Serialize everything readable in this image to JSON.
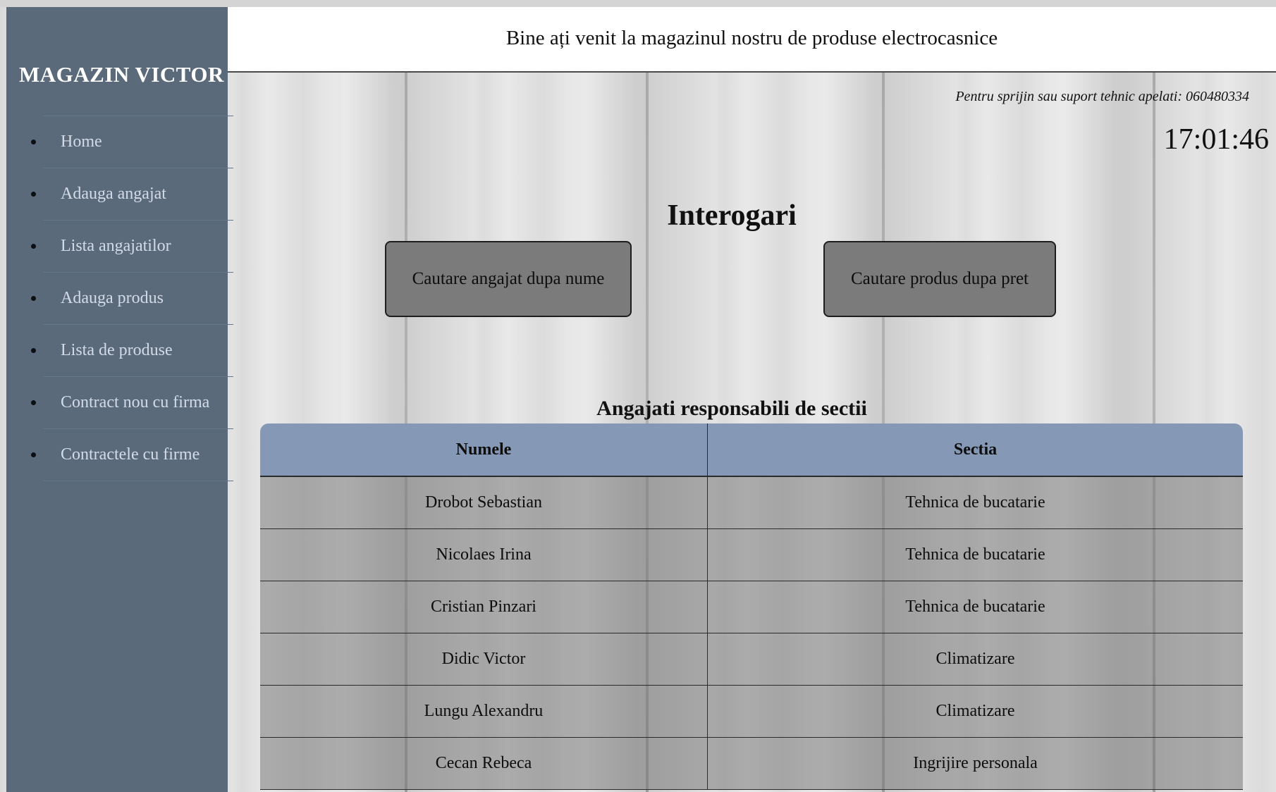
{
  "colors": {
    "sidebar_bg": "#5a6a7b",
    "sidebar_link": "#d3dbe6",
    "table_header_bg": "#8599b6",
    "button_bg": "#7b7b7b"
  },
  "sidebar": {
    "brand": "MAGAZIN VICTOR",
    "items": [
      {
        "label": "Home"
      },
      {
        "label": "Adauga angajat"
      },
      {
        "label": "Lista angajatilor"
      },
      {
        "label": "Adauga produs"
      },
      {
        "label": "Lista de produse"
      },
      {
        "label": "Contract nou cu firma"
      },
      {
        "label": "Contractele cu firme"
      }
    ]
  },
  "header": {
    "title": "Bine ați venit la magazinul nostru de produse electrocasnice"
  },
  "support": {
    "text": "Pentru sprijin sau suport tehnic apelati: 060480334"
  },
  "clock": {
    "time": "17:01:46"
  },
  "main": {
    "title": "Interogari",
    "buttons": {
      "search_employee": "Cautare angajat dupa nume",
      "search_product": "Cautare produs dupa pret"
    },
    "table": {
      "title": "Angajati responsabili de sectii",
      "columns": [
        "Numele",
        "Sectia"
      ],
      "rows": [
        [
          "Drobot Sebastian",
          "Tehnica de bucatarie"
        ],
        [
          "Nicolaes Irina",
          "Tehnica de bucatarie"
        ],
        [
          "Cristian Pinzari",
          "Tehnica de bucatarie"
        ],
        [
          "Didic Victor",
          "Climatizare"
        ],
        [
          "Lungu Alexandru",
          "Climatizare"
        ],
        [
          "Cecan Rebeca",
          "Ingrijire personala"
        ]
      ]
    }
  }
}
